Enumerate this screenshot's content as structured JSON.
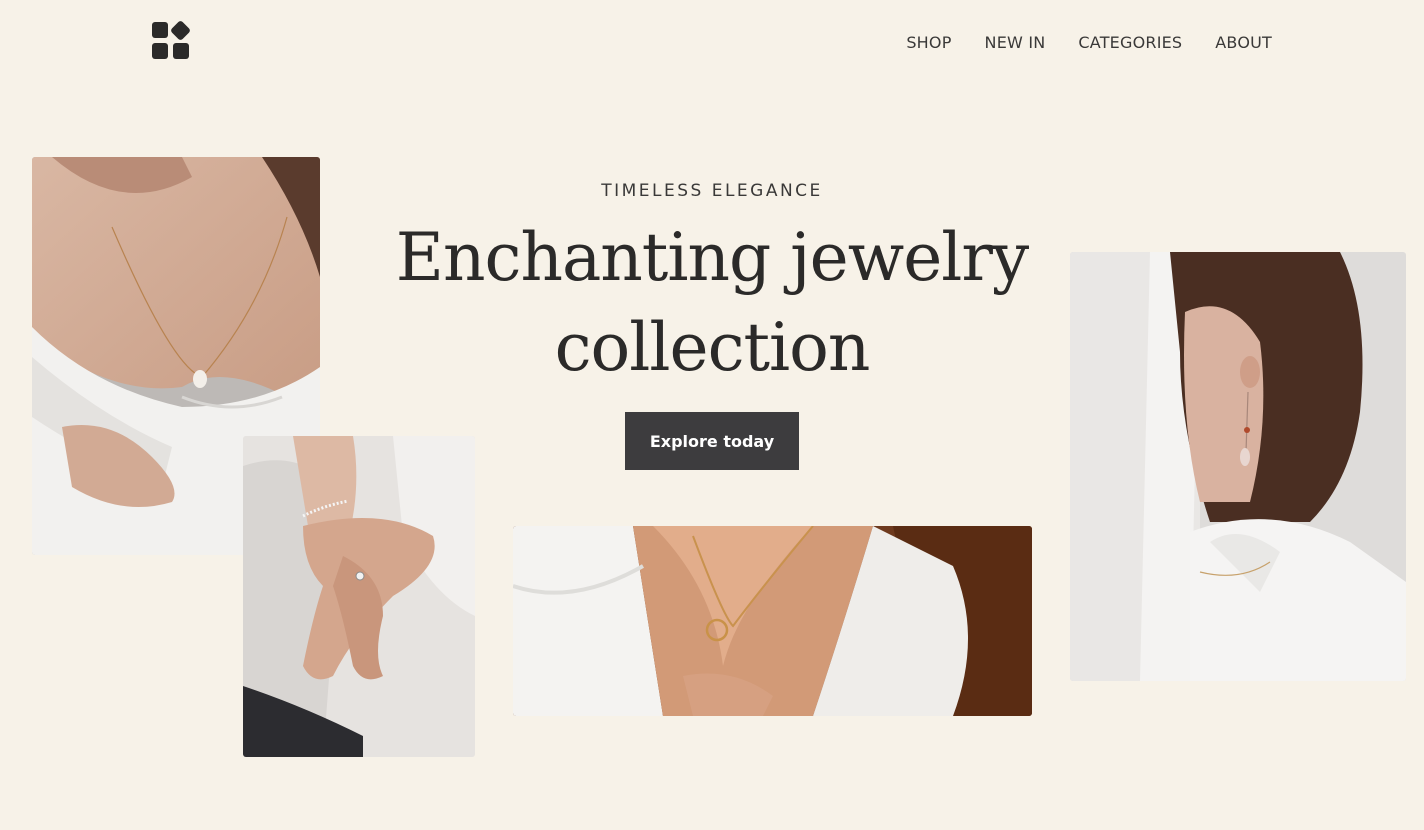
{
  "header": {
    "logo_icon": "four-squares-logo",
    "nav": [
      "SHOP",
      "NEW IN",
      "CATEGORIES",
      "ABOUT"
    ]
  },
  "hero": {
    "eyebrow": "TIMELESS ELEGANCE",
    "headline_line1": "Enchanting jewelry",
    "headline_line2": "collection",
    "cta_label": "Explore today"
  },
  "colors": {
    "background": "#f7f2e8",
    "text": "#2b2a29",
    "button": "#3d3c3e",
    "button_text": "#ffffff"
  }
}
